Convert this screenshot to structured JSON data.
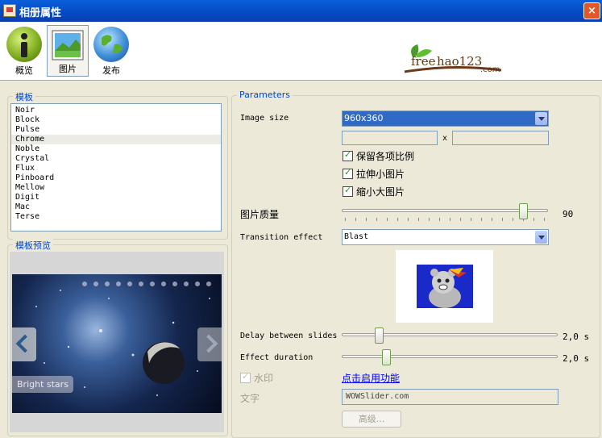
{
  "window": {
    "title": "相册属性",
    "close_glyph": "×"
  },
  "toolbar": {
    "overview_label": "概览",
    "images_label": "图片",
    "publish_label": "发布"
  },
  "logo": {
    "free": "free",
    "hao": "hao123",
    "com": ".com"
  },
  "templates": {
    "title": "模板",
    "items": [
      "Noir",
      "Block",
      "Pulse",
      "Chrome",
      "Noble",
      "Crystal",
      "Flux",
      "Pinboard",
      "Mellow",
      "Digit",
      "Mac",
      "Terse"
    ],
    "selected": "Chrome"
  },
  "preview": {
    "title": "模板预览",
    "caption": "Bright stars"
  },
  "parameters": {
    "title": "Parameters",
    "image_size_label": "Image size",
    "image_size_value": "960x360",
    "width_value": "",
    "x_label": "x",
    "height_value": "",
    "keep_ratio_label": "保留各项比例",
    "stretch_small_label": "拉伸小图片",
    "shrink_large_label": "缩小大图片",
    "quality_label": "图片质量",
    "quality_value": "90",
    "transition_label": "Transition effect",
    "transition_value": "Blast",
    "delay_label": "Delay between slides",
    "delay_value": "2,0 s",
    "duration_label": "Effect duration",
    "duration_value": "2,0 s",
    "watermark_label": "水印",
    "enable_link": "点击启用功能",
    "text_label": "文字",
    "text_value": "WOWSlider.com",
    "advanced_button": "高级..."
  },
  "colors": {
    "accent": "#316ac5",
    "panel_title": "#0046d5",
    "link": "#0000ff"
  }
}
